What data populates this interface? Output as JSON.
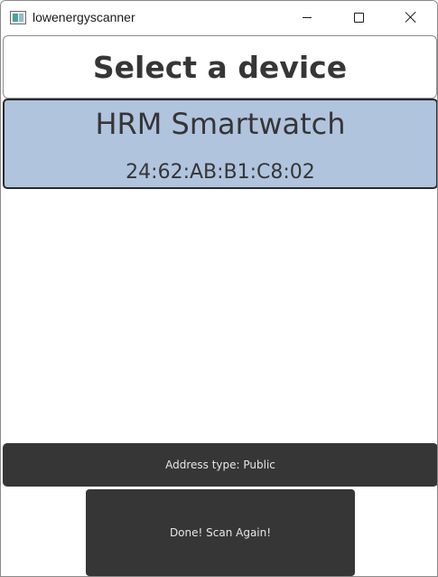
{
  "window": {
    "title": "lowenergyscanner",
    "icon": "app-window-icon",
    "controls": [
      "minimize-icon",
      "maximize-icon",
      "close-icon"
    ]
  },
  "header": {
    "title": "Select a device"
  },
  "devices": [
    {
      "name": "HRM Smartwatch",
      "address": "24:62:AB:B1:C8:02"
    }
  ],
  "footer": {
    "address_type_label": "Address type: Public",
    "scan_button_label": "Done! Scan Again!"
  },
  "colors": {
    "device_selected_bg": "#b0c4de",
    "button_bg": "#363636",
    "text_dark": "#363636",
    "text_light": "#e6e6e6"
  }
}
